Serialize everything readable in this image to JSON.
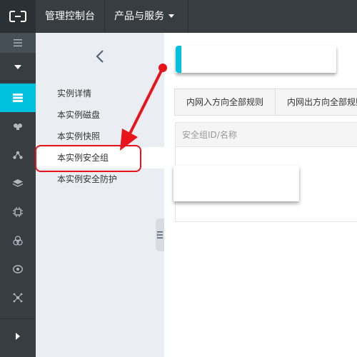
{
  "topbar": {
    "logo_icon": "aliyun-logo-icon",
    "console_label": "管理控制台",
    "products_label": "产品与服务",
    "background": "#373d41"
  },
  "rail": {
    "accent_color": "#00c1de",
    "icons": [
      "menu-icon",
      "caret-down-icon",
      "server-icon",
      "cloud-icon",
      "network-icon",
      "layers-icon",
      "chip-icon",
      "cluster-icon",
      "eye-icon",
      "molecule-icon",
      "expand-icon"
    ]
  },
  "sidebar": {
    "back_icon": "chevron-left-icon",
    "items": [
      {
        "label": "实例详情"
      },
      {
        "label": "本实例磁盘"
      },
      {
        "label": "本实例快照"
      },
      {
        "label": "本实例安全组"
      },
      {
        "label": "本实例安全防护"
      }
    ],
    "active_item": "本实例安全组"
  },
  "main": {
    "tabs": [
      {
        "label": "内网入方向全部规则"
      },
      {
        "label": "内网出方向全部规则"
      }
    ],
    "table": {
      "columns": [
        "安全组ID/名称"
      ]
    }
  },
  "annotation": {
    "color": "#e8141c"
  }
}
